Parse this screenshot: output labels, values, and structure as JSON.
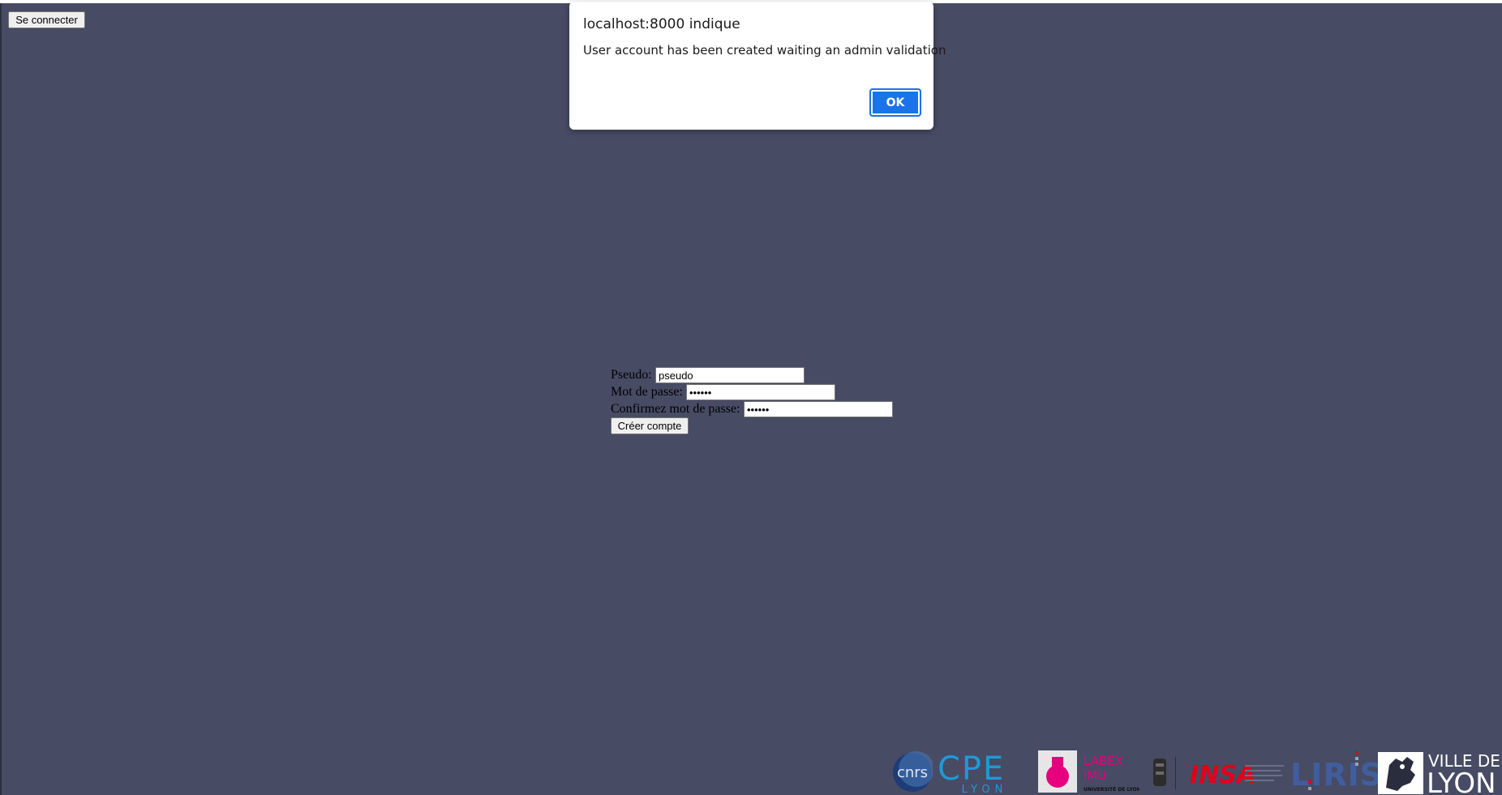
{
  "header": {
    "login_button_label": "Se connecter"
  },
  "form": {
    "pseudo_label": "Pseudo:",
    "pseudo_value": "pseudo",
    "password_label": "Mot de passe:",
    "password_value": "••••••",
    "confirm_label": "Confirmez mot de passe:",
    "confirm_value": "••••••",
    "create_button_label": "Créer compte"
  },
  "dialog": {
    "title": "localhost:8000 indique",
    "message": "User account has been created waiting an admin validation",
    "ok_label": "OK"
  },
  "footer": {
    "logos": [
      {
        "name": "cnrs-logo",
        "text": "cnrs"
      },
      {
        "name": "cpe-lyon-logo",
        "text": "CPE",
        "subtext": "LYON"
      },
      {
        "name": "labex-imu-logo",
        "text": "LABEX",
        "subtext": "IMU",
        "caption": "UNIVERSITÉ DE LYON"
      },
      {
        "name": "insa-logo",
        "text": "INSA"
      },
      {
        "name": "liris-logo",
        "text": "LIRIS"
      },
      {
        "name": "ville-de-lyon-logo",
        "text": "VILLE DE",
        "subtext": "LYON"
      }
    ]
  },
  "colors": {
    "background": "#474b64",
    "accent": "#1a73e8",
    "cpe_blue": "#1e9ad6",
    "labex_pink": "#e6007e",
    "insa_red": "#e2001a"
  }
}
